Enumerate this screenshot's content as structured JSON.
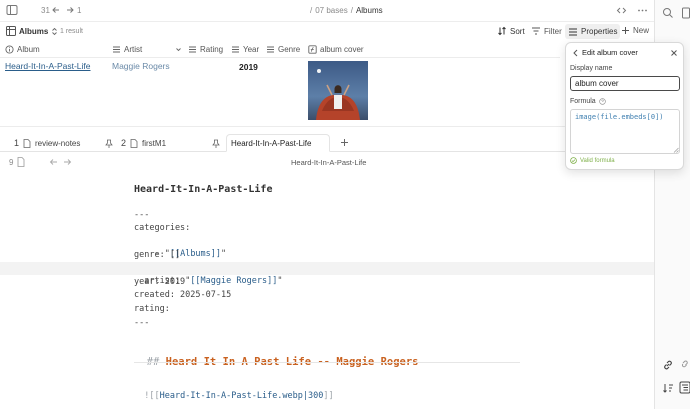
{
  "topbar": {
    "history_back_count": "31",
    "history_forward_count": "1",
    "path_folder": "07 bases",
    "path_sep": "/",
    "path_lead": "/",
    "path_file": "Albums"
  },
  "toolbar": {
    "view_name": "Albums",
    "result_count": "1 result",
    "sort_label": "Sort",
    "filter_label": "Filter",
    "properties_label": "Properties",
    "new_label": "New"
  },
  "table": {
    "columns": [
      "Album",
      "Artist",
      "Rating",
      "Year",
      "Genre",
      "album cover"
    ],
    "rows": [
      {
        "album": "Heard-It-In-A-Past-Life",
        "artist": "Maggie Rogers",
        "rating": "",
        "year": "2019",
        "genre": ""
      }
    ]
  },
  "tabs": [
    {
      "number": "1",
      "label": "review-notes",
      "pinned": true
    },
    {
      "number": "2",
      "label": "firstM1",
      "pinned": true
    },
    {
      "number": "",
      "label": "Heard-It-In-A-Past-Life",
      "active": true
    }
  ],
  "editor": {
    "line_number": "9",
    "header_title": "Heard-It-In-A-Past-Life",
    "inline_title": "Heard-It-In-A-Past-Life",
    "frontmatter": {
      "open": "---",
      "categories_key": "categories:",
      "categories_item_prefix": "  - \"",
      "categories_item_link": "[[Albums]]",
      "categories_item_suffix": "\"",
      "genre_line": "genre: []",
      "artist_prefix": "artist: \"",
      "artist_link": "[[Maggie Rogers]]",
      "artist_suffix": "\"",
      "year_line": "year: 2019",
      "created_line": "created: 2025-07-15",
      "rating_line": "rating:",
      "close": "---"
    },
    "heading_marker": "##",
    "heading_text": "Heard It In A Past Life -- Maggie Rogers",
    "embed_prefix": "![[",
    "embed_link": "Heard-It-In-A-Past-Life.webp|300",
    "embed_suffix": "]]"
  },
  "popover": {
    "title": "Edit album cover",
    "display_name_label": "Display name",
    "display_name_value": "album cover",
    "formula_label": "Formula",
    "formula_value": "image(file.embeds[0])",
    "status": "Valid formula"
  },
  "colors": {
    "heading_accent": "#c9611f",
    "link": "#2a5d8a",
    "valid": "#7fb04a",
    "formula_text": "#3f7fb0"
  }
}
